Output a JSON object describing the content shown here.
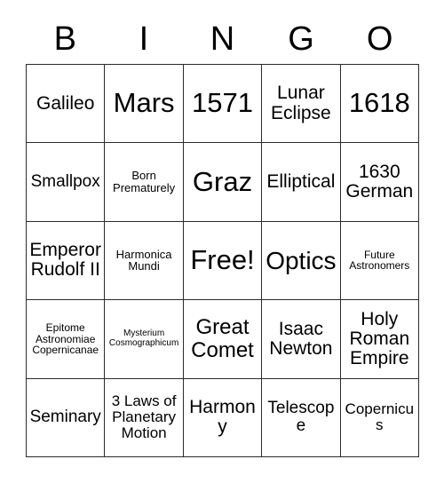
{
  "card": {
    "title": "Bingo Card",
    "header_letters": [
      "B",
      "I",
      "N",
      "G",
      "O"
    ],
    "colors": {
      "background": "#ffffff",
      "grid_line": "#2b2b2b",
      "text": "#000000"
    },
    "grid": {
      "columns": 5,
      "rows": 5,
      "free_space_label": "Free!"
    },
    "cells": [
      {
        "text": "Galileo",
        "size": "md"
      },
      {
        "text": "Mars",
        "size": "xxl"
      },
      {
        "text": "1571",
        "size": "xxl"
      },
      {
        "text": "Lunar\nEclipse",
        "size": "md"
      },
      {
        "text": "1618",
        "size": "xxl"
      },
      {
        "text": "Smallpox",
        "size": "sm"
      },
      {
        "text": "Born\nPrematurely",
        "size": "xxs"
      },
      {
        "text": "Graz",
        "size": "xxl"
      },
      {
        "text": "Elliptical",
        "size": "md"
      },
      {
        "text": "1630\nGerman",
        "size": "md"
      },
      {
        "text": "Emperor\nRudolf II",
        "size": "md"
      },
      {
        "text": "Harmonica\nMundi",
        "size": "xxs"
      },
      {
        "text": "Free!",
        "size": "xxl"
      },
      {
        "text": "Optics",
        "size": "xl"
      },
      {
        "text": "Future\nAstronomers",
        "size": "tiny"
      },
      {
        "text": "Epitome\nAstronomiae\nCopernicanae",
        "size": "tiny"
      },
      {
        "text": "Mysterium\nCosmographicum",
        "size": "mini"
      },
      {
        "text": "Great\nComet",
        "size": "lg"
      },
      {
        "text": "Isaac\nNewton",
        "size": "md"
      },
      {
        "text": "Holy\nRoman\nEmpire",
        "size": "md"
      },
      {
        "text": "Seminary",
        "size": "sm"
      },
      {
        "text": "3 Laws of\nPlanetary\nMotion",
        "size": "xs"
      },
      {
        "text": "Harmony",
        "size": "md"
      },
      {
        "text": "Telescope",
        "size": "sm"
      },
      {
        "text": "Copernicus",
        "size": "xs"
      }
    ]
  }
}
